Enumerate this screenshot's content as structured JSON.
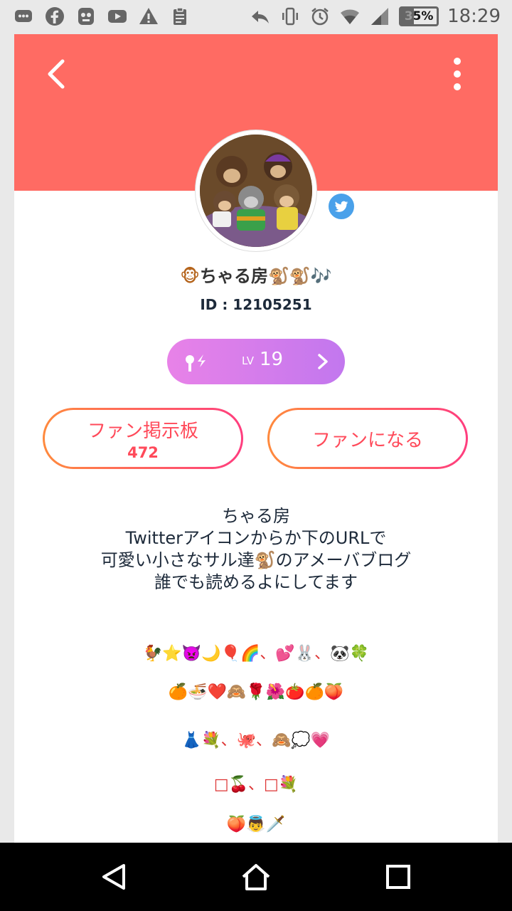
{
  "status_bar": {
    "left_icons": [
      "chat-icon",
      "facebook-icon",
      "ghost-icon",
      "youtube-icon",
      "warning-icon",
      "clipboard-icon"
    ],
    "right_icons": [
      "reply-icon",
      "vibrate-icon",
      "alarm-icon",
      "wifi-icon",
      "signal-icon"
    ],
    "battery_text": "35%",
    "battery_level": 0.35,
    "time": "18:29"
  },
  "colors": {
    "header": "#ff6b63",
    "level_pill": "#d97cec",
    "button_gradient_start": "#ff8a3d",
    "button_gradient_end": "#ff3d7f",
    "twitter": "#4aa1ea"
  },
  "profile": {
    "name_prefix": "🐵",
    "name": "ちゃる房",
    "name_suffix": "🐒🐒🎶",
    "id_label": "ID : 12105251",
    "level_prefix": "LV",
    "level": "19"
  },
  "buttons": {
    "fan_board_label": "ファン掲示板",
    "fan_board_count": "472",
    "become_fan_label": "ファンになる"
  },
  "bio": {
    "line1": "ちゃる房",
    "line2": "Twitterアイコンからか下のURLで",
    "line3a": "可愛い小さなサル達",
    "line3_emoji": "🐒",
    "line3b": "のアメーバブログ",
    "line4": "誰でも読めるよにしてます"
  },
  "emoji_lines": [
    "🐓⭐👿🌙🎈🌈、💕🐰、🐼🍀",
    "🍊🍜❤️🙈🌹🌺🍅🍊🍑",
    "👗💐、🐙、🙈💭💗",
    "□🍒、□💐",
    "🍑👼🗡️"
  ],
  "nav": [
    "back-nav-icon",
    "home-nav-icon",
    "recents-nav-icon"
  ]
}
